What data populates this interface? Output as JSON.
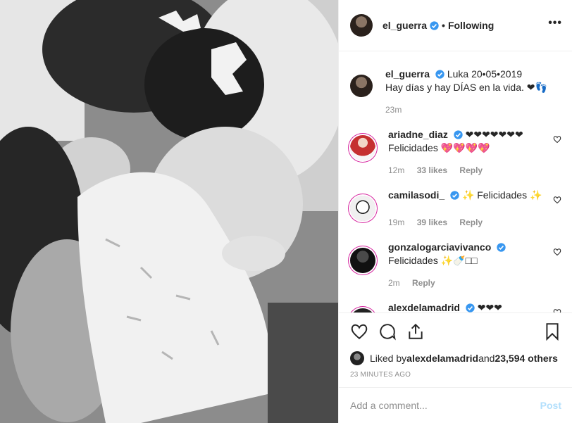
{
  "post": {
    "username": "el_guerra",
    "following_label": "Following",
    "separator": "•",
    "more_label": "•••"
  },
  "caption": {
    "username": "el_guerra",
    "text_line1": "Luka 20•05•2019",
    "text_line2": "Hay días y hay DÍAS en la vida. ❤👣",
    "time": "23m"
  },
  "comments": [
    {
      "username": "ariadne_diaz",
      "text": "❤❤❤❤❤❤❤",
      "text2": "Felicidades 💖💖💖💖",
      "time": "12m",
      "likes": "33 likes",
      "reply": "Reply"
    },
    {
      "username": "camilasodi_",
      "text": "✨ Felicidades ✨",
      "text2": "",
      "time": "19m",
      "likes": "39 likes",
      "reply": "Reply"
    },
    {
      "username": "gonzalogarciavivanco",
      "text": "",
      "text2": "Felicidades ✨🍼□□",
      "time": "2m",
      "likes": "",
      "reply": "Reply"
    },
    {
      "username": "alexdelamadrid",
      "text": "❤❤❤",
      "text2": "",
      "time": "",
      "likes": "",
      "reply": ""
    }
  ],
  "likes": {
    "prefix": "Liked by ",
    "user": "alexdelamadrid",
    "middle": " and ",
    "count": "23,594 others"
  },
  "timestamp": "23 MINUTES AGO",
  "add_comment": {
    "placeholder": "Add a comment...",
    "post_label": "Post"
  },
  "colors": {
    "verified_blue": "#3897f0",
    "post_disabled": "#b2dffc",
    "meta_gray": "#8e8e8e"
  },
  "icons": [
    "heart-icon",
    "comment-icon",
    "share-icon",
    "bookmark-icon",
    "verified-icon",
    "more-icon"
  ]
}
